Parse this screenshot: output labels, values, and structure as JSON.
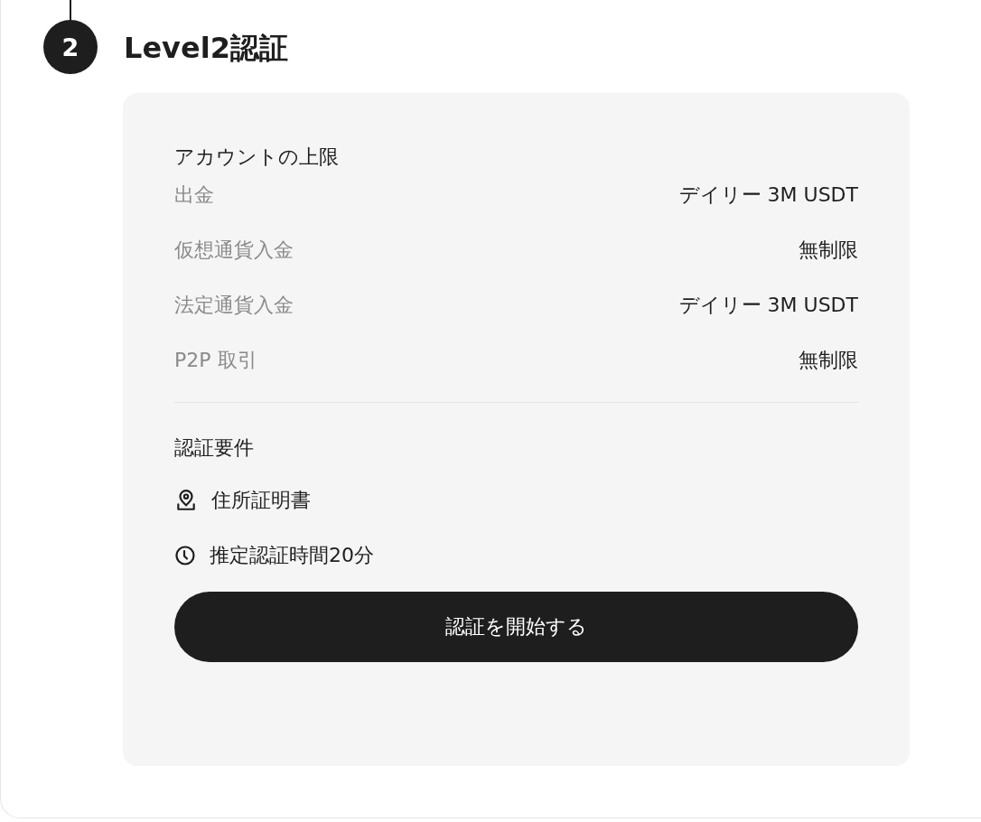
{
  "step": {
    "number": "2",
    "title": "Level2認証"
  },
  "limits": {
    "heading": "アカウントの上限",
    "rows": [
      {
        "label": "出金",
        "value": "デイリー 3M USDT"
      },
      {
        "label": "仮想通貨入金",
        "value": "無制限"
      },
      {
        "label": "法定通貨入金",
        "value": "デイリー 3M USDT"
      },
      {
        "label": "P2P 取引",
        "value": "無制限"
      }
    ]
  },
  "requirements": {
    "heading": "認証要件",
    "items": [
      {
        "kind": "location",
        "text": "住所証明書"
      },
      {
        "kind": "clock",
        "text": "推定認証時間20分"
      }
    ]
  },
  "button": "認証を開始する"
}
